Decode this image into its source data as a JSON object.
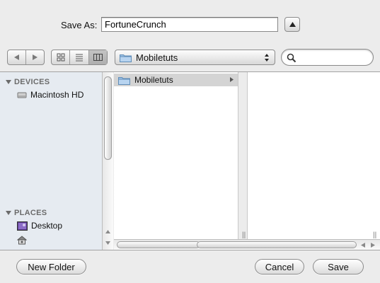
{
  "save_as": {
    "label": "Save As:",
    "filename": "FortuneCrunch"
  },
  "toolbar": {
    "back_icon": "triangle-left-icon",
    "forward_icon": "triangle-right-icon",
    "views": [
      "icon-view",
      "list-view",
      "column-view"
    ],
    "selected_view": "column-view",
    "location": "Mobiletuts",
    "search_placeholder": ""
  },
  "sidebar": {
    "devices_header": "DEVICES",
    "devices": [
      {
        "label": "Macintosh HD",
        "icon": "hard-drive-icon"
      }
    ],
    "places_header": "PLACES",
    "places": [
      {
        "label": "Desktop",
        "icon": "desktop-icon"
      },
      {
        "label": "",
        "icon": "home-icon"
      }
    ]
  },
  "columns": [
    {
      "items": [
        {
          "label": "Mobiletuts",
          "icon": "folder-icon",
          "selected": true,
          "has_children": true
        }
      ]
    },
    {
      "items": []
    }
  ],
  "buttons": {
    "new_folder": "New Folder",
    "cancel": "Cancel",
    "save": "Save"
  },
  "colors": {
    "selection": "#d4d4d4",
    "sidebar_bg": "#e6ebf1",
    "window_bg": "#ececec"
  }
}
